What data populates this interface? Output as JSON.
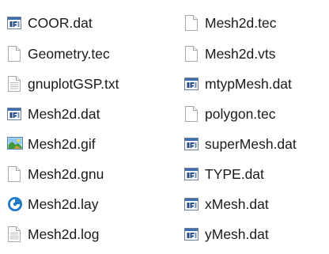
{
  "file_list": {
    "columns": [
      [
        {
          "name": "COOR.dat",
          "icon": "dat-file-icon"
        },
        {
          "name": "Geometry.tec",
          "icon": "blank-file-icon"
        },
        {
          "name": "gnuplotGSP.txt",
          "icon": "text-file-icon"
        },
        {
          "name": "Mesh2d.dat",
          "icon": "dat-file-icon"
        },
        {
          "name": "Mesh2d.gif",
          "icon": "image-file-icon"
        },
        {
          "name": "Mesh2d.gnu",
          "icon": "blank-file-icon"
        },
        {
          "name": "Mesh2d.lay",
          "icon": "tecplot-layout-icon"
        },
        {
          "name": "Mesh2d.log",
          "icon": "text-file-icon"
        }
      ],
      [
        {
          "name": "Mesh2d.tec",
          "icon": "blank-file-icon"
        },
        {
          "name": "Mesh2d.vts",
          "icon": "blank-file-icon"
        },
        {
          "name": "mtypMesh.dat",
          "icon": "dat-file-icon"
        },
        {
          "name": "polygon.tec",
          "icon": "blank-file-icon"
        },
        {
          "name": "superMesh.dat",
          "icon": "dat-file-icon"
        },
        {
          "name": "TYPE.dat",
          "icon": "dat-file-icon"
        },
        {
          "name": "xMesh.dat",
          "icon": "dat-file-icon"
        },
        {
          "name": "yMesh.dat",
          "icon": "dat-file-icon"
        }
      ]
    ]
  }
}
